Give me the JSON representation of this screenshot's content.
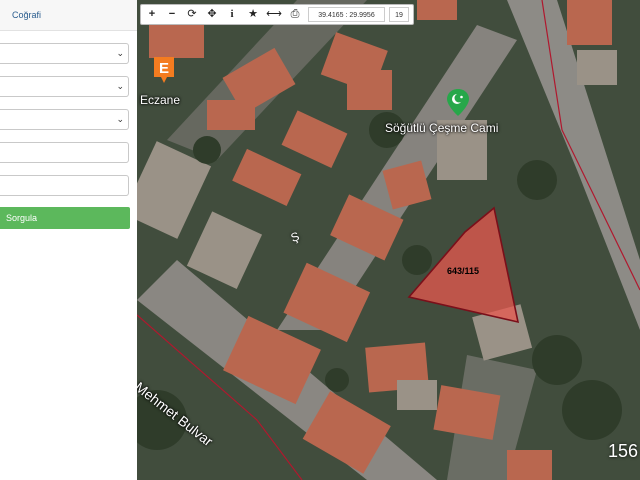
{
  "panel": {
    "tab_label": "Coğrafi",
    "dropdowns": [
      "",
      "",
      ""
    ],
    "inputs": [
      "",
      ""
    ],
    "query_label": "Sorgula"
  },
  "toolbar": {
    "zoom_in": "+",
    "zoom_out": "−",
    "refresh": "⟳",
    "pan": "✥",
    "info": "i",
    "favorite": "★",
    "measure": "⟷",
    "print": "⎙",
    "coordinates": "39.4165 : 29.9956",
    "zoom_level": "19"
  },
  "map": {
    "poi_pharmacy": "Eczane",
    "poi_pharmacy_letter": "E",
    "poi_mosque": "Söğütlü Çeşme Cami",
    "parcel_label": "643/115",
    "street_label": "ıltan Mehmet Bulvar",
    "street_small": "Ş",
    "scale_text": "156"
  },
  "colors": {
    "parcel_fill": "#e8584f",
    "parcel_stroke": "#7a0f1a",
    "boundary": "#b0182e",
    "pharmacy": "#f47c20",
    "mosque": "#27a74a",
    "query_button": "#5cb85c"
  }
}
